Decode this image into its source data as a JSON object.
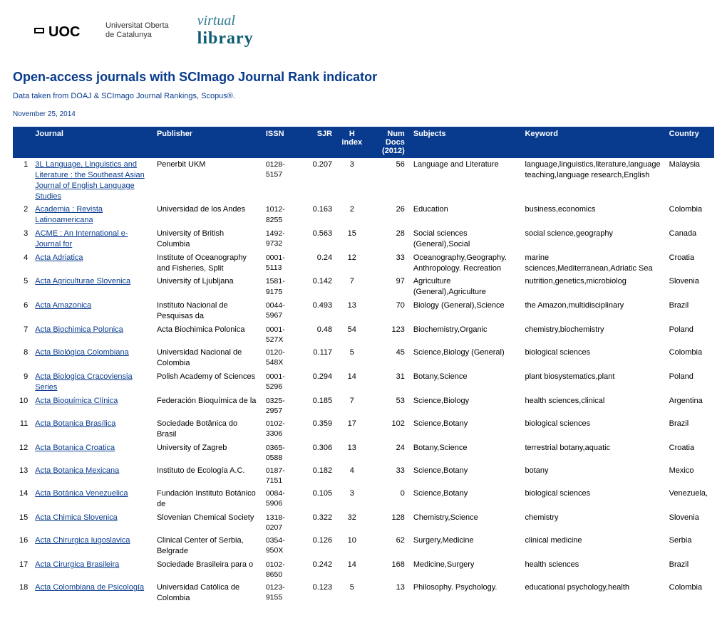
{
  "logo": {
    "uoc_mark": "⬛ UOC",
    "uoc_text_line1": "Universitat Oberta",
    "uoc_text_line2": "de Catalunya",
    "vl_top": "virtual",
    "vl_bot": "library"
  },
  "title": "Open-access journals with SCImago Journal Rank indicator",
  "subtitle": "Data taken from DOAJ & SCImago Journal Rankings, Scopus®.",
  "date": "November 25, 2014",
  "headers": {
    "journal": "Journal",
    "publisher": "Publisher",
    "issn": "ISSN",
    "sjr": "SJR",
    "h_top": "H",
    "h_bot": "index",
    "docs_top": "Num Docs",
    "docs_bot": "(2012)",
    "subjects": "Subjects",
    "keyword": "Keyword",
    "country": "Country"
  },
  "rows": [
    {
      "n": 1,
      "journal": "3L Language, Linguistics and Literature : the Southeast Asian Journal of English Language Studies",
      "publisher": "Penerbit UKM",
      "issn": "0128-5157",
      "sjr": "0.207",
      "h": "3",
      "docs": "56",
      "subjects": "Language and Literature",
      "keyword": "language,linguistics,literature,language teaching,language research,English",
      "country": "Malaysia"
    },
    {
      "n": 2,
      "journal": "Academia : Revista Latinoamericana",
      "publisher": "Universidad de los Andes",
      "issn": "1012-8255",
      "sjr": "0.163",
      "h": "2",
      "docs": "26",
      "subjects": "Education",
      "keyword": "business,economics",
      "country": "Colombia"
    },
    {
      "n": 3,
      "journal": "ACME : An International e-Journal for",
      "publisher": "University of British Columbia",
      "issn": "1492-9732",
      "sjr": "0.563",
      "h": "15",
      "docs": "28",
      "subjects": "Social sciences (General),Social",
      "keyword": "social science,geography",
      "country": "Canada"
    },
    {
      "n": 4,
      "journal": "Acta Adriatica",
      "publisher": "Institute of Oceanography and Fisheries, Split",
      "issn": "0001-5113",
      "sjr": "0.24",
      "h": "12",
      "docs": "33",
      "subjects": "Oceanography,Geography. Anthropology. Recreation",
      "keyword": "marine sciences,Mediterranean,Adriatic Sea",
      "country": "Croatia"
    },
    {
      "n": 5,
      "journal": "Acta Agriculturae Slovenica",
      "publisher": "University of Ljubljana",
      "issn": "1581-9175",
      "sjr": "0.142",
      "h": "7",
      "docs": "97",
      "subjects": "Agriculture (General),Agriculture",
      "keyword": "nutrition,genetics,microbiolog",
      "country": "Slovenia"
    },
    {
      "n": 6,
      "journal": "Acta Amazonica",
      "publisher": "Instituto Nacional de Pesquisas da",
      "issn": "0044-5967",
      "sjr": "0.493",
      "h": "13",
      "docs": "70",
      "subjects": "Biology (General),Science",
      "keyword": "the Amazon,multidisciplinary",
      "country": "Brazil"
    },
    {
      "n": 7,
      "journal": "Acta Biochimica Polonica",
      "publisher": "Acta Biochimica Polonica",
      "issn": "0001-527X",
      "sjr": "0.48",
      "h": "54",
      "docs": "123",
      "subjects": "Biochemistry,Organic",
      "keyword": "chemistry,biochemistry",
      "country": "Poland"
    },
    {
      "n": 8,
      "journal": "Acta Biológica Colombiana",
      "publisher": "Universidad Nacional de Colombia",
      "issn": "0120-548X",
      "sjr": "0.117",
      "h": "5",
      "docs": "45",
      "subjects": "Science,Biology (General)",
      "keyword": "biological sciences",
      "country": "Colombia"
    },
    {
      "n": 9,
      "journal": "Acta Biologica Cracoviensia Series",
      "publisher": "Polish Academy of Sciences",
      "issn": "0001-5296",
      "sjr": "0.294",
      "h": "14",
      "docs": "31",
      "subjects": "Botany,Science",
      "keyword": "plant biosystematics,plant",
      "country": "Poland"
    },
    {
      "n": 10,
      "journal": "Acta Bioquímica Clínica",
      "publisher": "Federación Bioquímica de la",
      "issn": "0325-2957",
      "sjr": "0.185",
      "h": "7",
      "docs": "53",
      "subjects": "Science,Biology",
      "keyword": "health sciences,clinical",
      "country": "Argentina"
    },
    {
      "n": 11,
      "journal": "Acta Botanica Brasílica",
      "publisher": "Sociedade Botânica do Brasil",
      "issn": "0102-3306",
      "sjr": "0.359",
      "h": "17",
      "docs": "102",
      "subjects": "Science,Botany",
      "keyword": "biological sciences",
      "country": "Brazil"
    },
    {
      "n": 12,
      "journal": "Acta Botanica Croatica",
      "publisher": "University of Zagreb",
      "issn": "0365-0588",
      "sjr": "0.306",
      "h": "13",
      "docs": "24",
      "subjects": "Botany,Science",
      "keyword": "terrestrial botany,aquatic",
      "country": "Croatia"
    },
    {
      "n": 13,
      "journal": "Acta Botanica Mexicana",
      "publisher": "Instituto de Ecología A.C.",
      "issn": "0187-7151",
      "sjr": "0.182",
      "h": "4",
      "docs": "33",
      "subjects": "Science,Botany",
      "keyword": "botany",
      "country": "Mexico"
    },
    {
      "n": 14,
      "journal": "Acta Botánica Venezuelica",
      "publisher": "Fundación Instituto Botánico de",
      "issn": "0084-5906",
      "sjr": "0.105",
      "h": "3",
      "docs": "0",
      "subjects": "Science,Botany",
      "keyword": "biological sciences",
      "country": "Venezuela,"
    },
    {
      "n": 15,
      "journal": "Acta Chimica Slovenica",
      "publisher": "Slovenian Chemical Society",
      "issn": "1318-0207",
      "sjr": "0.322",
      "h": "32",
      "docs": "128",
      "subjects": "Chemistry,Science",
      "keyword": "chemistry",
      "country": "Slovenia"
    },
    {
      "n": 16,
      "journal": "Acta Chirurgica Iugoslavica",
      "publisher": "Clinical Center of Serbia, Belgrade",
      "issn": "0354-950X",
      "sjr": "0.126",
      "h": "10",
      "docs": "62",
      "subjects": "Surgery,Medicine",
      "keyword": "clinical medicine",
      "country": "Serbia"
    },
    {
      "n": 17,
      "journal": "Acta Cirurgica Brasileira",
      "publisher": "Sociedade Brasileira para o",
      "issn": "0102-8650",
      "sjr": "0.242",
      "h": "14",
      "docs": "168",
      "subjects": "Medicine,Surgery",
      "keyword": "health sciences",
      "country": "Brazil"
    },
    {
      "n": 18,
      "journal": "Acta Colombiana de Psicología",
      "publisher": "Universidad Católica de Colombia",
      "issn": "0123-9155",
      "sjr": "0.123",
      "h": "5",
      "docs": "13",
      "subjects": "Philosophy. Psychology.",
      "keyword": "educational psychology,health",
      "country": "Colombia"
    }
  ]
}
